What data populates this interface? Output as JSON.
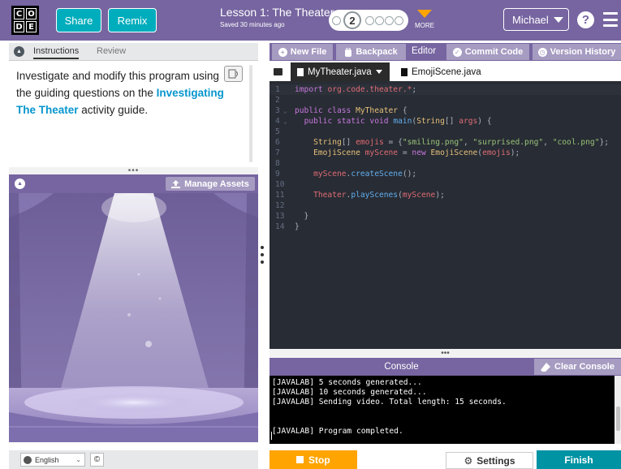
{
  "header": {
    "logo_letters": [
      "C",
      "O",
      "D",
      "E"
    ],
    "share_label": "Share",
    "remix_label": "Remix",
    "lesson_title": "Lesson 1: The Theater",
    "saved_text": "Saved 30 minutes ago",
    "current_level": "2",
    "more_label": "MORE",
    "user_name": "Michael",
    "help_glyph": "?"
  },
  "instructions": {
    "tabs": [
      "Instructions",
      "Review"
    ],
    "text_before": "Investigate and modify this program using the guiding questions on the",
    "link_text": "Investigating The Theater",
    "text_after": " activity guide.",
    "divider_dots": "•••"
  },
  "visualization": {
    "manage_assets_label": "Manage Assets"
  },
  "footer": {
    "language": "English",
    "copyright_glyph": "©"
  },
  "editor": {
    "new_file_label": "New File",
    "backpack_label": "Backpack",
    "editor_label": "Editor",
    "commit_code_label": "Commit Code",
    "version_history_label": "Version History",
    "file_tabs": [
      "MyTheater.java",
      "EmojiScene.java"
    ],
    "active_file": "MyTheater.java",
    "code_lines": [
      {
        "n": "1",
        "fold": "",
        "tokens": [
          [
            "kw",
            "import "
          ],
          [
            "var",
            "org.code.theater.*"
          ],
          [
            "pl",
            ";"
          ]
        ]
      },
      {
        "n": "2",
        "fold": "",
        "tokens": []
      },
      {
        "n": "3",
        "fold": "⌄",
        "tokens": [
          [
            "kw",
            "public class "
          ],
          [
            "cls",
            "MyTheater"
          ],
          [
            "pl",
            " {"
          ]
        ]
      },
      {
        "n": "4",
        "fold": "⌄",
        "tokens": [
          [
            "pl",
            "  "
          ],
          [
            "kw",
            "public static void "
          ],
          [
            "fn",
            "main"
          ],
          [
            "pl",
            "("
          ],
          [
            "cls",
            "String"
          ],
          [
            "pl",
            "[] "
          ],
          [
            "var",
            "args"
          ],
          [
            "pl",
            ") {"
          ]
        ]
      },
      {
        "n": "5",
        "fold": "",
        "tokens": []
      },
      {
        "n": "6",
        "fold": "",
        "tokens": [
          [
            "pl",
            "    "
          ],
          [
            "cls",
            "String"
          ],
          [
            "pl",
            "[] "
          ],
          [
            "var",
            "emojis"
          ],
          [
            "pl",
            " = {"
          ],
          [
            "str",
            "\"smiling.png\""
          ],
          [
            "pl",
            ", "
          ],
          [
            "str",
            "\"surprised.png\""
          ],
          [
            "pl",
            ", "
          ],
          [
            "str",
            "\"cool.png\""
          ],
          [
            "pl",
            "};"
          ]
        ]
      },
      {
        "n": "7",
        "fold": "",
        "tokens": [
          [
            "pl",
            "    "
          ],
          [
            "cls",
            "EmojiScene "
          ],
          [
            "var",
            "myScene"
          ],
          [
            "pl",
            " = "
          ],
          [
            "kw",
            "new "
          ],
          [
            "cls",
            "EmojiScene"
          ],
          [
            "pl",
            "("
          ],
          [
            "var",
            "emojis"
          ],
          [
            "pl",
            ");"
          ]
        ]
      },
      {
        "n": "8",
        "fold": "",
        "tokens": []
      },
      {
        "n": "9",
        "fold": "",
        "tokens": [
          [
            "pl",
            "    "
          ],
          [
            "var",
            "myScene"
          ],
          [
            "pl",
            "."
          ],
          [
            "fn",
            "createScene"
          ],
          [
            "pl",
            "();"
          ]
        ]
      },
      {
        "n": "10",
        "fold": "",
        "tokens": []
      },
      {
        "n": "11",
        "fold": "",
        "tokens": [
          [
            "pl",
            "    "
          ],
          [
            "var",
            "Theater"
          ],
          [
            "pl",
            "."
          ],
          [
            "fn",
            "playScenes"
          ],
          [
            "pl",
            "("
          ],
          [
            "var",
            "myScene"
          ],
          [
            "pl",
            ");"
          ]
        ]
      },
      {
        "n": "12",
        "fold": "",
        "tokens": []
      },
      {
        "n": "13",
        "fold": "",
        "tokens": [
          [
            "pl",
            "  }"
          ]
        ]
      },
      {
        "n": "14",
        "fold": "",
        "tokens": [
          [
            "pl",
            "}"
          ]
        ]
      }
    ]
  },
  "console": {
    "divider_dots": "•••",
    "title": "Console",
    "clear_label": "Clear Console",
    "lines": [
      "[JAVALAB] 5 seconds generated...",
      "[JAVALAB] 10 seconds generated...",
      "[JAVALAB] Sending video. Total length: 15 seconds.",
      "",
      "",
      "[JAVALAB] Program completed."
    ]
  },
  "bottom": {
    "stop_label": "Stop",
    "settings_label": "Settings",
    "finish_label": "Finish"
  },
  "colors": {
    "header_purple": "#7665a0",
    "teal": "#00adbc",
    "orange": "#ffa400",
    "link_blue": "#0596ce",
    "finish_teal": "#0093a4"
  }
}
